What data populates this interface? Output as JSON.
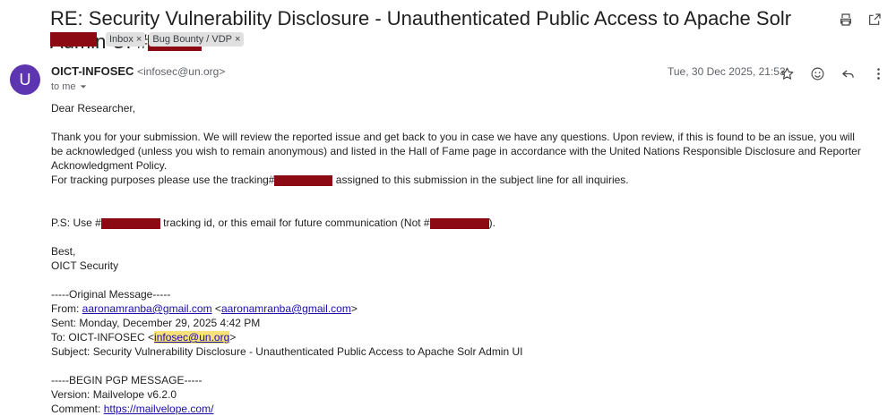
{
  "subject": "RE: Security Vulnerability Disclosure - Unauthenticated Public Access to Apache Solr Admin UI #",
  "labels": [
    {
      "label": "Inbox"
    },
    {
      "label": "Bug Bounty / VDP"
    }
  ],
  "icons": {
    "print": "print-icon",
    "open_new": "open-in-new-icon",
    "star": "star-icon",
    "emoji": "emoji-icon",
    "reply": "reply-icon",
    "more": "more-vert-icon"
  },
  "sender": {
    "initial": "U",
    "name": "OICT-INFOSEC",
    "email": "<infosec@un.org>",
    "to": "to me",
    "date": "Tue, 30 Dec 2025, 21:53"
  },
  "body": {
    "greeting": "Dear Researcher,",
    "p1": "Thank you for your submission. We will review the reported issue and get back to you in case we have any questions. Upon review, if this is found to be an issue, you will be acknowledged (unless you wish to remain anonymous) and listed in the Hall of Fame page in accordance with the United Nations Responsible Disclosure and Reporter Acknowledgment Policy.",
    "p2_a": "For tracking purposes please use the tracking#",
    "p2_b": " assigned to this submission in the subject line for all inquiries.",
    "ps_a": "P.S: Use #",
    "ps_b": " tracking id, or this email for future communication (Not #",
    "ps_c": ").",
    "signoff": "Best,",
    "signature": "OICT Security",
    "orig_header": "-----Original Message-----",
    "from_label": "From: ",
    "from_email": "aaronamranba@gmail.com",
    "from_email2_pre": " <",
    "from_email2": "aaronamranba@gmail.com",
    "from_email2_post": ">",
    "sent": "Sent: Monday, December 29, 2025 4:42 PM",
    "to_label": "To: OICT-INFOSEC <",
    "to_email": "infosec@un.org",
    "to_close": ">",
    "orig_subject": "Subject: Security Vulnerability Disclosure - Unauthenticated Public Access to Apache Solr Admin UI",
    "pgp_begin": "-----BEGIN PGP MESSAGE-----",
    "version": "Version: Mailvelope v6.2.0",
    "comment_label": "Comment: ",
    "comment_link": "https://mailvelope.com/"
  },
  "colors": {
    "redaction": "#8b0a14",
    "avatar": "#5e35b1",
    "link": "#1a0dab",
    "highlight": "#f9e27a"
  }
}
